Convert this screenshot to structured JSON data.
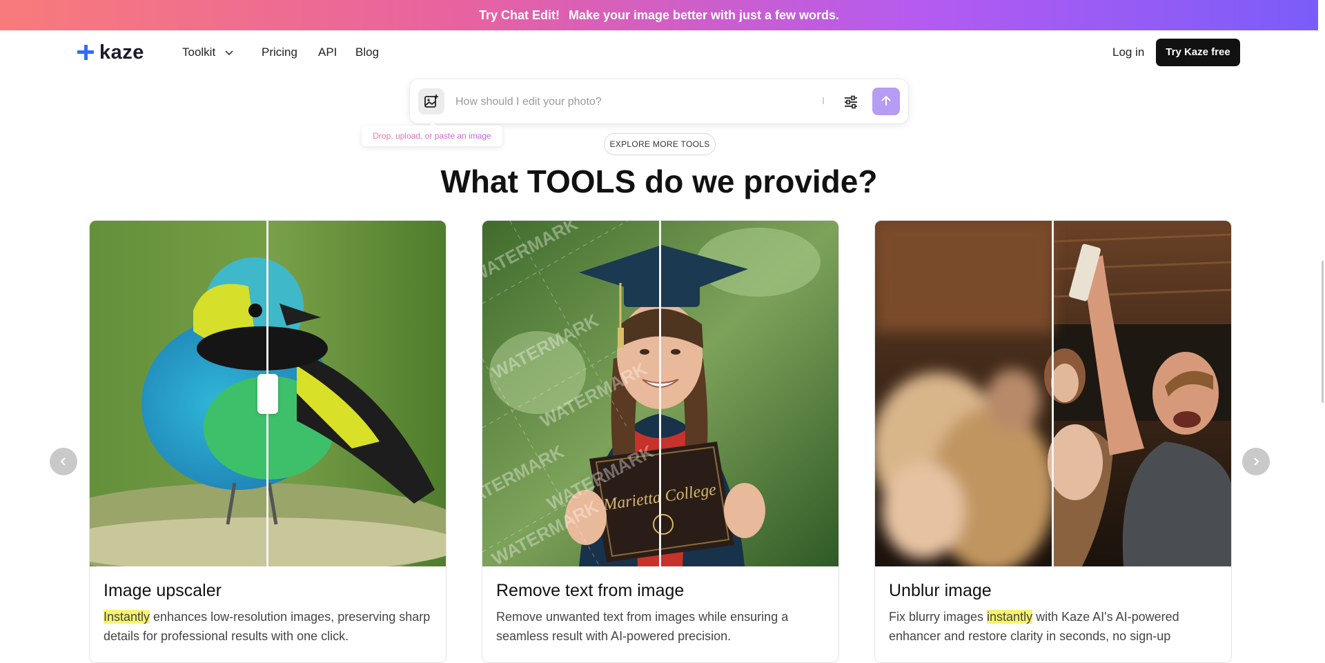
{
  "banner": {
    "part1": "Try Chat Edit!",
    "part2": "Make your image better with just a few words."
  },
  "nav": {
    "brand": "kaze",
    "toolkit": "Toolkit",
    "pricing": "Pricing",
    "api": "API",
    "blog": "Blog",
    "login": "Log in",
    "cta": "Try Kaze free"
  },
  "editor": {
    "placeholder": "How should I edit your photo?",
    "tooltip": "Drop, upload, or paste an image"
  },
  "explore": "EXPLORE MORE TOOLS",
  "section_title": "What TOOLS do we provide?",
  "cards": [
    {
      "title": "Image upscaler",
      "desc_hl": "Instantly",
      "desc_rest": " enhances low-resolution images, preserving sharp details for professional results with one click."
    },
    {
      "title": "Remove text from image",
      "desc_plain": "Remove unwanted text from images while ensuring a seamless result with AI-powered precision."
    },
    {
      "title": "Unblur image",
      "desc_pre": "Fix blurry images ",
      "desc_hl": "instantly",
      "desc_post": " with Kaze AI's AI-powered enhancer and restore clarity in seconds, no sign-up"
    }
  ],
  "graphic_text": {
    "watermark": "WATERMARK",
    "diploma": "Marietta College"
  },
  "colors": {
    "send_button": "#b69cf3",
    "cta_bg": "#111111",
    "highlight": "#f6f46e",
    "brand_blue": "#2f6ff0"
  }
}
